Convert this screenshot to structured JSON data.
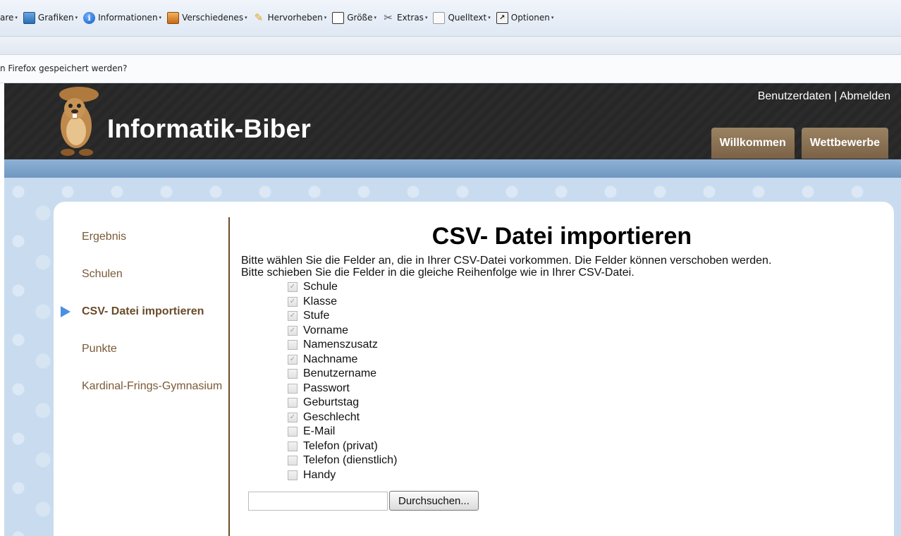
{
  "browser": {
    "toolbar_items": [
      {
        "label": "are",
        "icon": "none"
      },
      {
        "label": "Grafiken",
        "icon": "image-icon"
      },
      {
        "label": "Informationen",
        "icon": "info-icon"
      },
      {
        "label": "Verschiedenes",
        "icon": "misc-icon"
      },
      {
        "label": "Hervorheben",
        "icon": "pencil-icon"
      },
      {
        "label": "Größe",
        "icon": "resize-icon"
      },
      {
        "label": "Extras",
        "icon": "tools-icon"
      },
      {
        "label": "Quelltext",
        "icon": "source-icon"
      },
      {
        "label": "Optionen",
        "icon": "options-icon"
      }
    ],
    "notification": "n Firefox gespeichert werden?"
  },
  "site": {
    "title": "Informatik-Biber",
    "user_links": {
      "account": "Benutzerdaten",
      "separator": "|",
      "logout": "Abmelden"
    },
    "tabs": [
      {
        "label": "Willkommen"
      },
      {
        "label": "Wettbewerbe"
      }
    ]
  },
  "sidebar": {
    "items": [
      {
        "label": "Ergebnis",
        "active": false
      },
      {
        "label": "Schulen",
        "active": false
      },
      {
        "label": "CSV- Datei importieren",
        "active": true
      },
      {
        "label": "Punkte",
        "active": false
      },
      {
        "label": "Kardinal-Frings-Gymnasium",
        "active": false
      }
    ]
  },
  "main": {
    "heading": "CSV- Datei importieren",
    "intro_line1": "Bitte wählen Sie die Felder an, die in Ihrer CSV-Datei vorkommen. Die Felder können verschoben werden.",
    "intro_line2": "Bitte schieben Sie die Felder in die gleiche Reihenfolge wie in Ihrer CSV-Datei.",
    "fields": [
      {
        "label": "Schule",
        "checked": true
      },
      {
        "label": "Klasse",
        "checked": true
      },
      {
        "label": "Stufe",
        "checked": true
      },
      {
        "label": "Vorname",
        "checked": true
      },
      {
        "label": "Namenszusatz",
        "checked": false
      },
      {
        "label": "Nachname",
        "checked": true
      },
      {
        "label": "Benutzername",
        "checked": false
      },
      {
        "label": "Passwort",
        "checked": false
      },
      {
        "label": "Geburtstag",
        "checked": false
      },
      {
        "label": "Geschlecht",
        "checked": true
      },
      {
        "label": "E-Mail",
        "checked": false
      },
      {
        "label": "Telefon (privat)",
        "checked": false
      },
      {
        "label": "Telefon (dienstlich)",
        "checked": false
      },
      {
        "label": "Handy",
        "checked": false
      }
    ],
    "file_input_value": "",
    "browse_label": "Durchsuchen..."
  },
  "colors": {
    "header_bg": "#2b2b2b",
    "tab_bg": "#8a7052",
    "nav_text": "#7a5a37",
    "band": "#7fa4cc",
    "active_arrow": "#4a8fe3"
  }
}
